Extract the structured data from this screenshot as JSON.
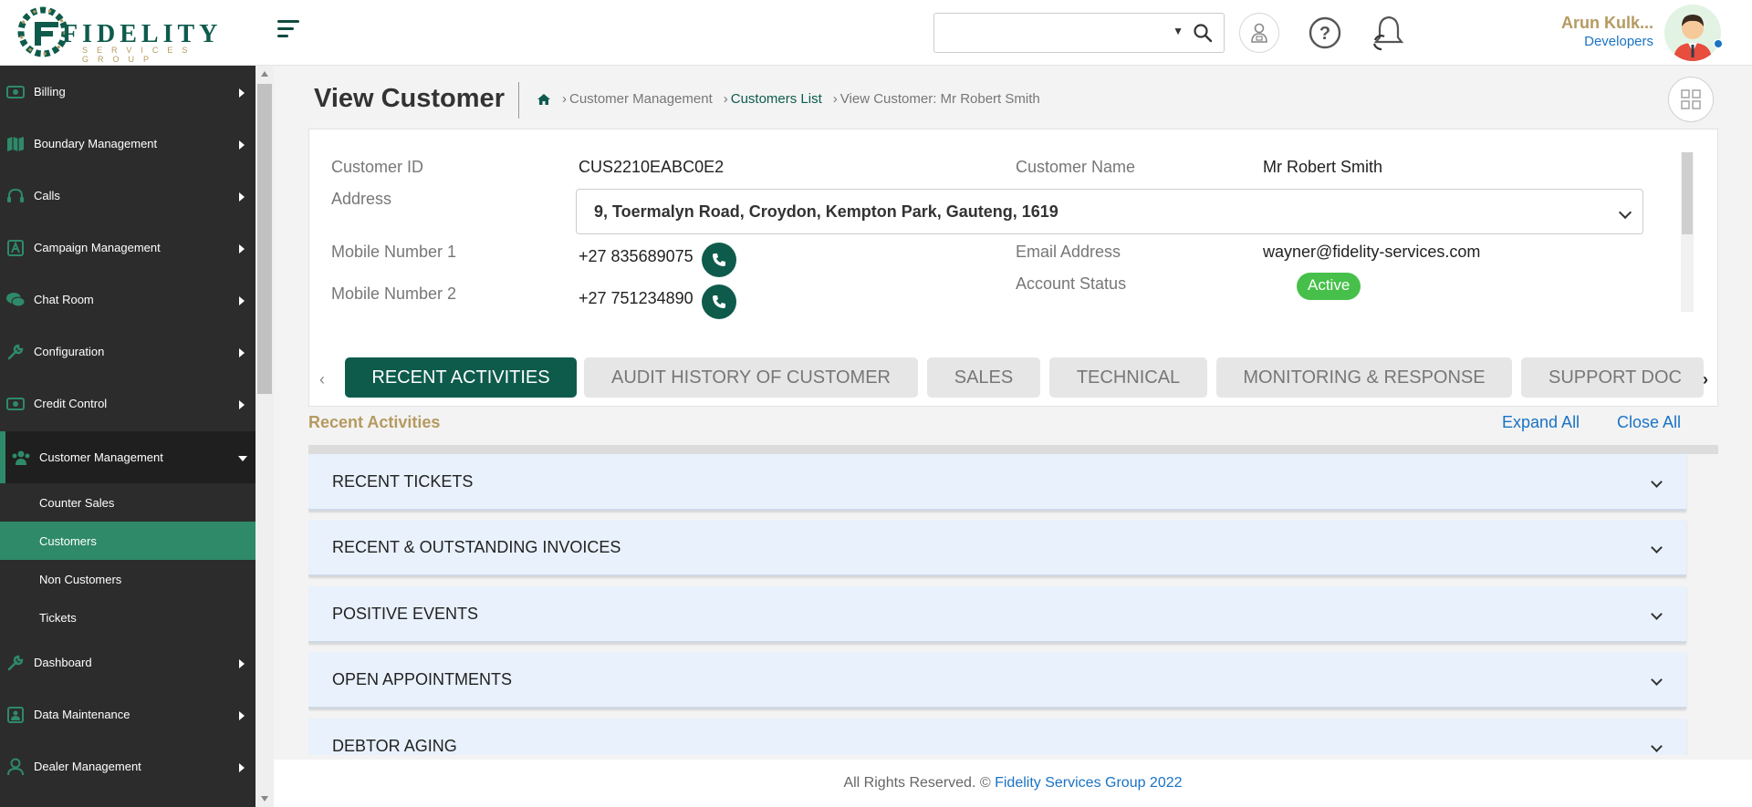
{
  "brand": {
    "title": "FIDELITY",
    "subtitle": "SERVICES GROUP"
  },
  "search": {
    "value": ""
  },
  "user": {
    "name": "Arun Kulk...",
    "role": "Developers"
  },
  "sidebar": {
    "items": [
      {
        "label": "Billing",
        "icon": "money-icon"
      },
      {
        "label": "Boundary Management",
        "icon": "map-icon"
      },
      {
        "label": "Calls",
        "icon": "headset-icon"
      },
      {
        "label": "Campaign Management",
        "icon": "campaign-icon"
      },
      {
        "label": "Chat Room",
        "icon": "chat-icon"
      },
      {
        "label": "Configuration",
        "icon": "wrench-icon"
      },
      {
        "label": "Credit Control",
        "icon": "money-icon"
      },
      {
        "label": "Customer Management",
        "icon": "users-icon"
      },
      {
        "label": "Dashboard",
        "icon": "wrench-icon"
      },
      {
        "label": "Data Maintenance",
        "icon": "database-icon"
      },
      {
        "label": "Dealer Management",
        "icon": "user-icon"
      }
    ],
    "subitems": [
      {
        "label": "Counter Sales"
      },
      {
        "label": "Customers"
      },
      {
        "label": "Non Customers"
      },
      {
        "label": "Tickets"
      }
    ]
  },
  "page": {
    "title": "View Customer",
    "breadcrumb": [
      "Customer Management",
      "Customers List",
      "View Customer: Mr Robert Smith"
    ]
  },
  "customer": {
    "id_label": "Customer ID",
    "id": "CUS2210EABC0E2",
    "name_label": "Customer Name",
    "name": "Mr Robert Smith",
    "address_label": "Address",
    "address": "9, Toermalyn Road, Croydon, Kempton Park, Gauteng, 1619",
    "mobile1_label": "Mobile Number 1",
    "mobile1": "+27 835689075",
    "mobile2_label": "Mobile Number 2",
    "mobile2": "+27 751234890",
    "email_label": "Email Address",
    "email": "wayner@fidelity-services.com",
    "status_label": "Account Status",
    "status": "Active",
    "status_color": "#46c04a"
  },
  "tabs": [
    "RECENT ACTIVITIES",
    "AUDIT HISTORY OF CUSTOMER",
    "SALES",
    "TECHNICAL",
    "MONITORING & RESPONSE",
    "SUPPORT DOC"
  ],
  "section": {
    "title": "Recent Activities",
    "expand_all": "Expand All",
    "close_all": "Close All"
  },
  "accordions": [
    "RECENT TICKETS",
    "RECENT & OUTSTANDING INVOICES",
    "POSITIVE EVENTS",
    "OPEN APPOINTMENTS",
    "DEBTOR AGING"
  ],
  "footer": {
    "text": "All Rights Reserved. ©",
    "link": "Fidelity Services Group 2022"
  },
  "colors": {
    "brand": "#0e5b4c",
    "accent": "#2e8a68",
    "gold": "#b59a60",
    "link": "#1a73c4"
  }
}
